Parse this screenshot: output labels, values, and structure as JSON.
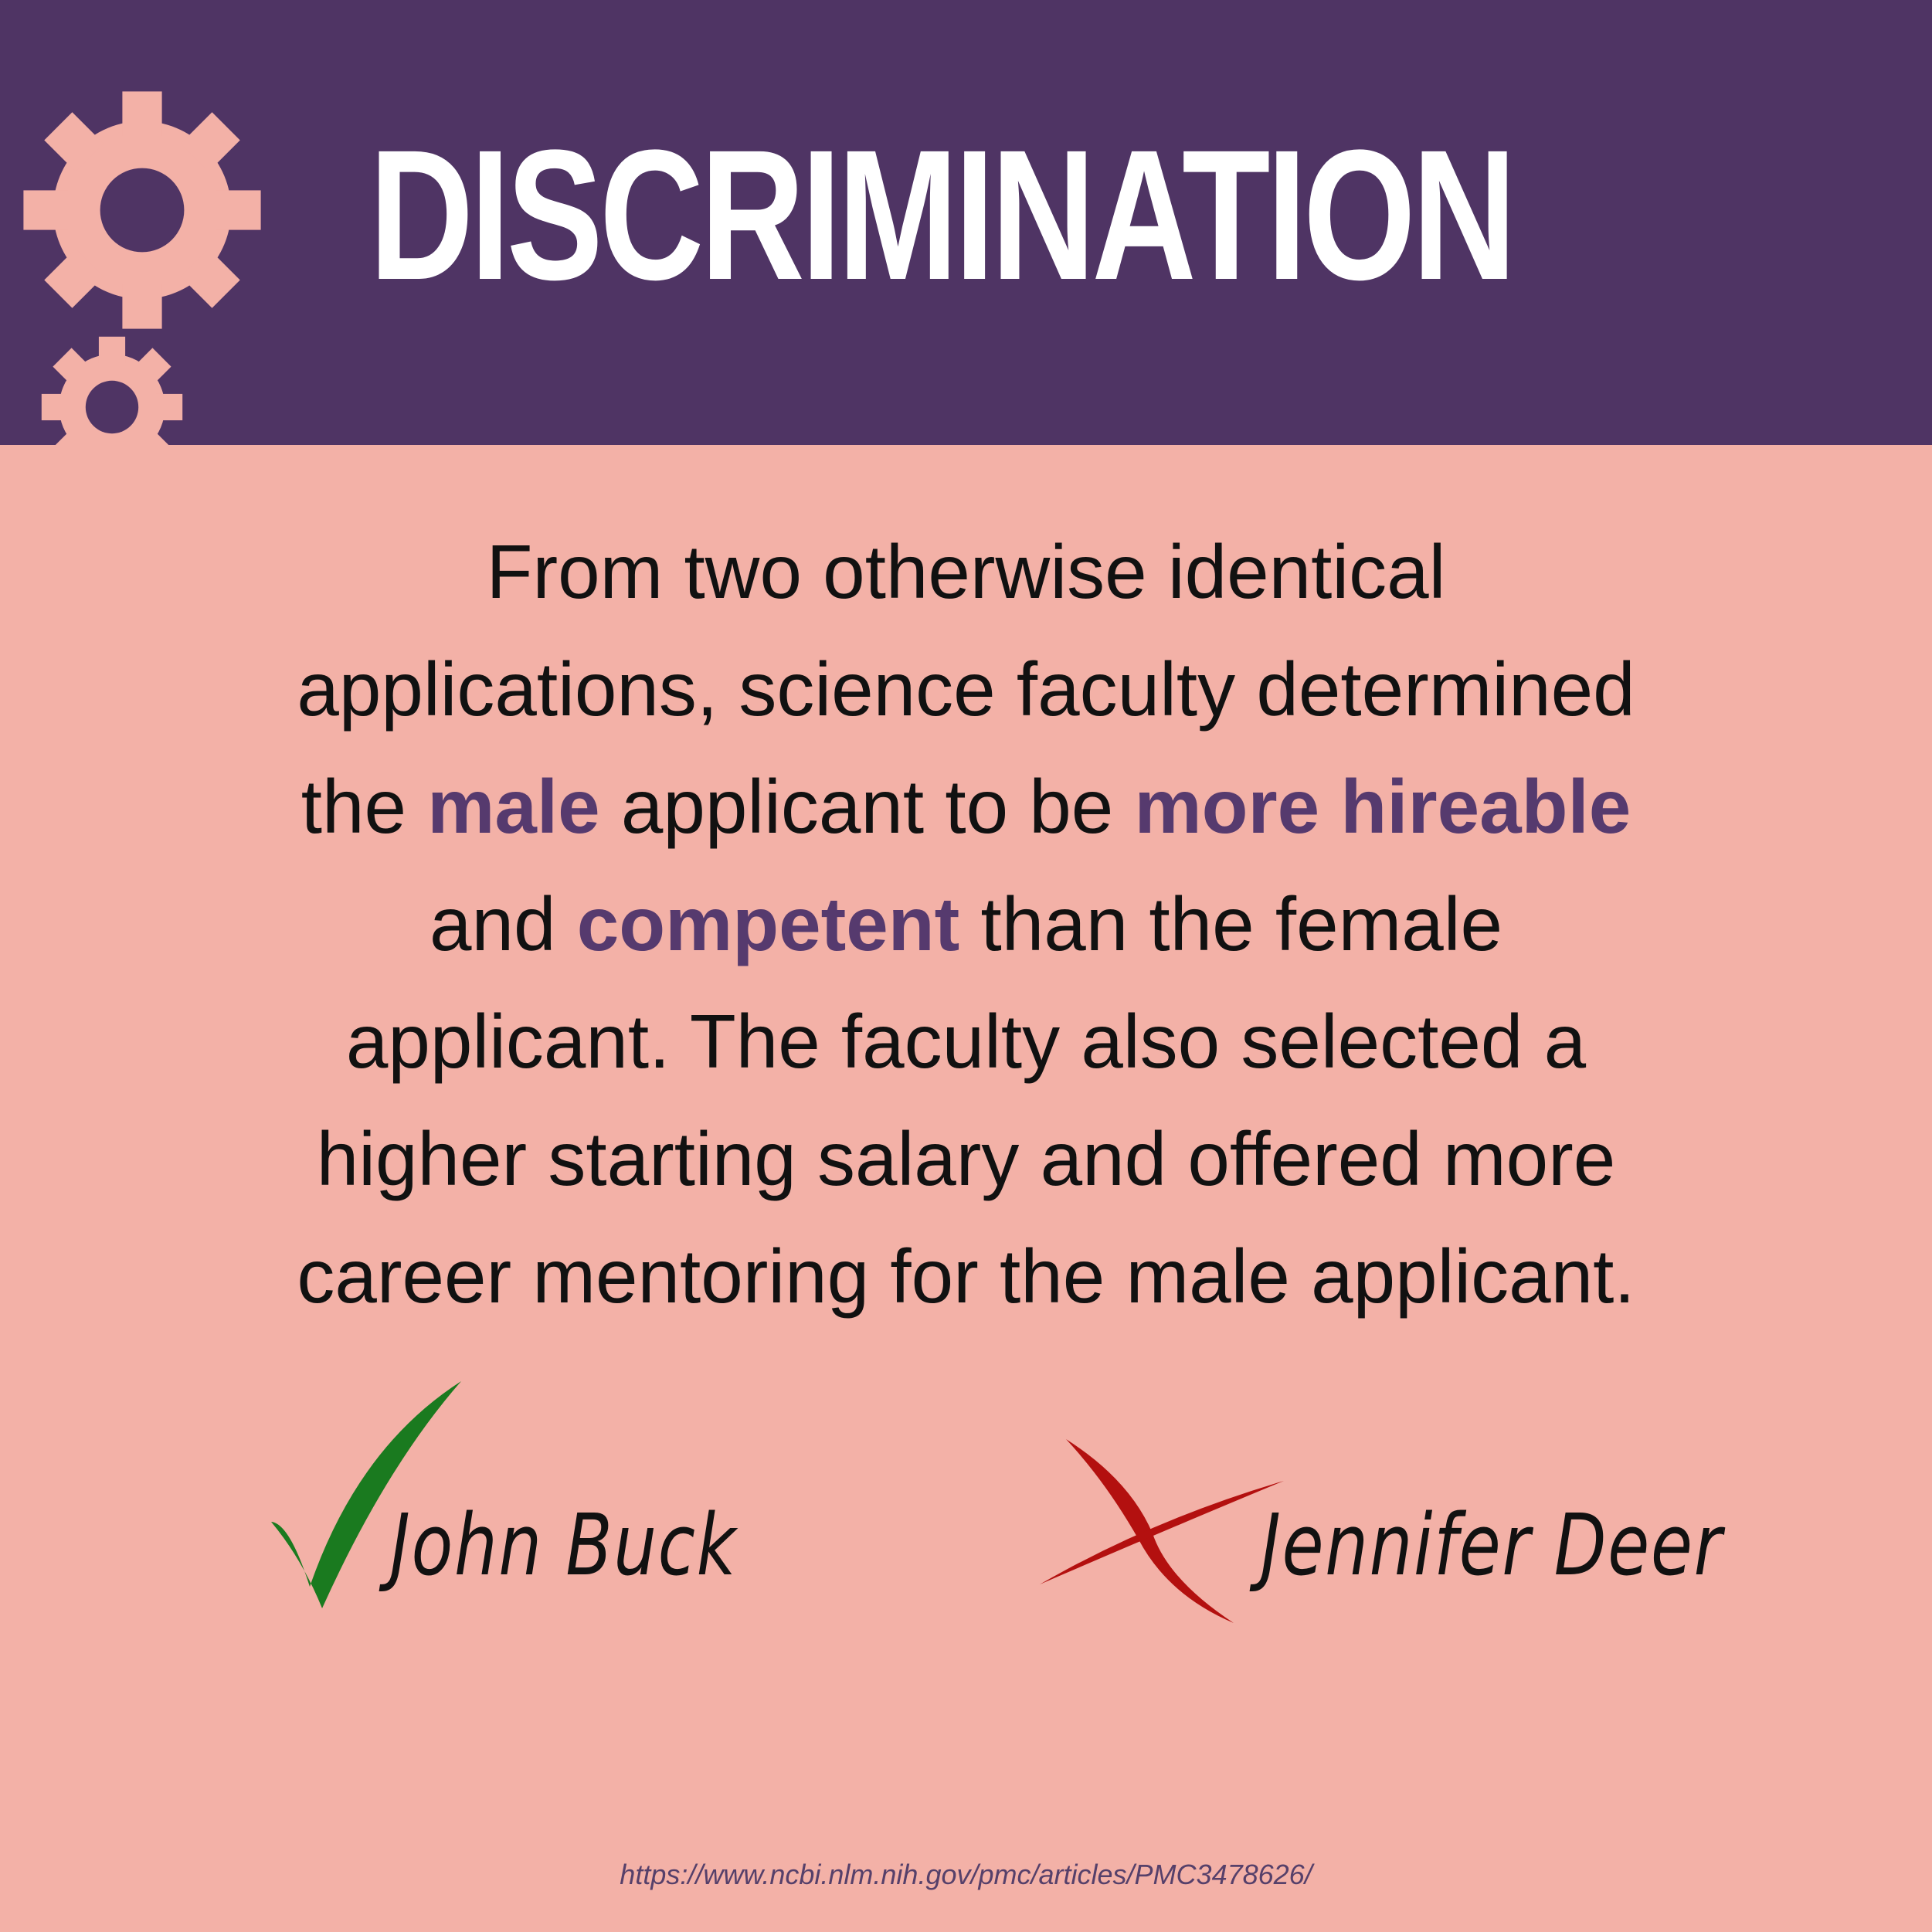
{
  "header": {
    "title": "DISCRIMINATION",
    "icons": [
      "gear-icon",
      "gear-icon"
    ]
  },
  "body": {
    "line1": "From two otherwise identical",
    "line2": "applications, science faculty determined",
    "line3_a": "the ",
    "line3_b": "male",
    "line3_c": " applicant to be ",
    "line3_d": "more hireable",
    "line4_a": "and ",
    "line4_b": "competent",
    "line4_c": " than the female",
    "line5": "applicant. The faculty also selected a",
    "line6": "higher starting salary and offered more",
    "line7": "career mentoring for the male applicant."
  },
  "candidates": {
    "accepted": {
      "name": "John  Buck",
      "icon": "check-mark-icon"
    },
    "rejected": {
      "name": "Jennifer  Deer",
      "icon": "cross-mark-icon"
    }
  },
  "source": "https://www.ncbi.nlm.nih.gov/pmc/articles/PMC3478626/",
  "colors": {
    "header_bg": "#4f3464",
    "background": "#f3b1a7",
    "gear": "#f3b1a7",
    "highlight": "#563a6e",
    "check": "#1a7a1f",
    "cross": "#b3100f"
  }
}
